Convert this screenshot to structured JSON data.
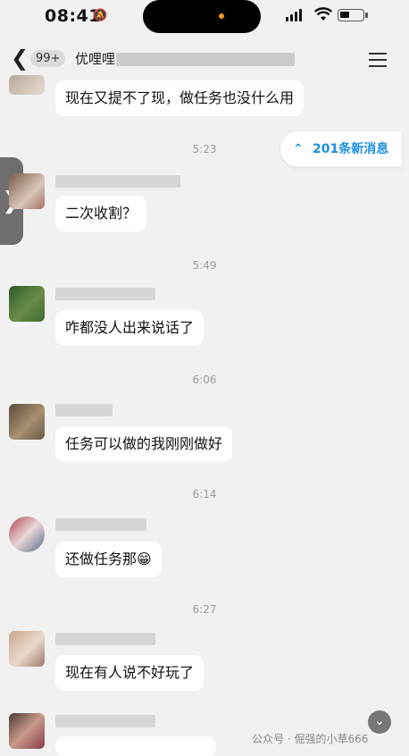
{
  "status_bar": {
    "time": "08:41"
  },
  "nav": {
    "unread_count": "99+",
    "title": "优哩哩"
  },
  "new_messages": {
    "label": "201条新消息"
  },
  "messages": [
    {
      "text": "现在又提不了现，做任务也没什么用"
    },
    {
      "timestamp": "5:23",
      "text": "二次收割？"
    },
    {
      "timestamp": "5:49",
      "text": "咋都没人出来说话了"
    },
    {
      "timestamp": "6:06",
      "text": "任务可以做的我刚刚做好"
    },
    {
      "timestamp": "6:14",
      "text": "还做任务那"
    },
    {
      "timestamp": "6:27",
      "text": "现在有人说不好玩了"
    }
  ],
  "watermark": "公众号 · 倔强的小草666",
  "colors": {
    "accent": "#1a8fe3",
    "background": "#f1f1f1",
    "bubble": "#ffffff"
  }
}
